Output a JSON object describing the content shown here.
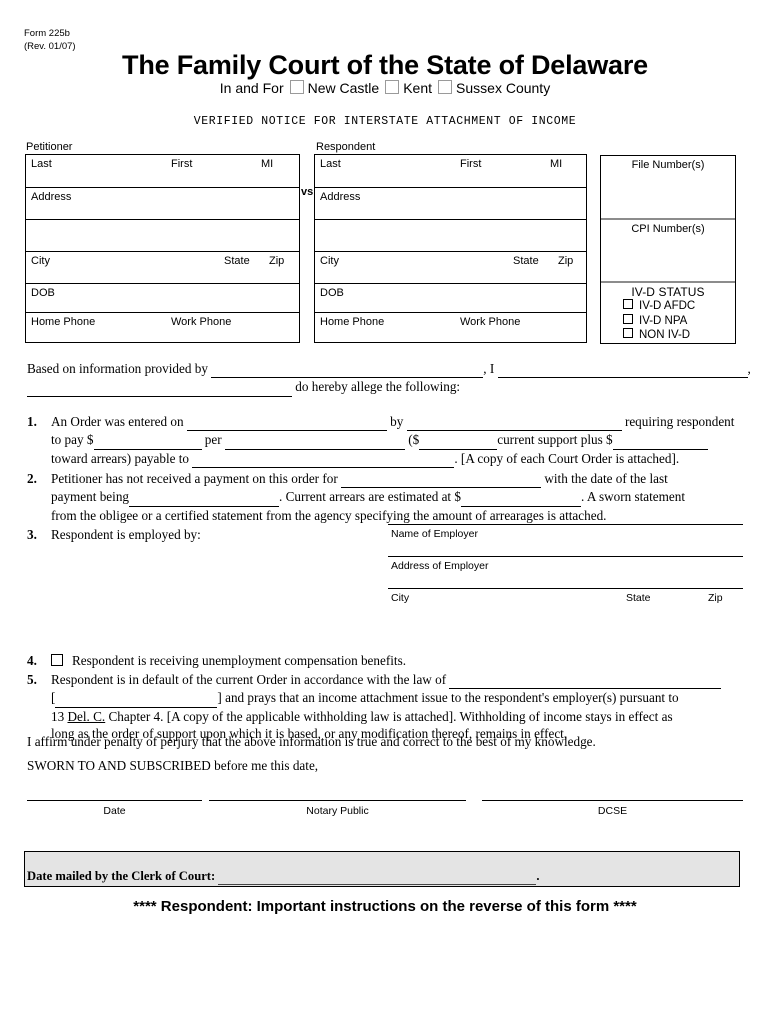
{
  "form": {
    "number": "Form 225b",
    "revision": "(Rev. 01/07)"
  },
  "header": {
    "title": "The Family Court of the State of Delaware",
    "in_and_for_label": "In and For",
    "counties": [
      "New Castle",
      "Kent",
      "Sussex County"
    ],
    "subtitle": "VERIFIED NOTICE FOR INTERSTATE ATTACHMENT OF INCOME"
  },
  "parties": {
    "petitioner_label": "Petitioner",
    "respondent_label": "Respondent",
    "vs": "vs",
    "fields": {
      "last": "Last",
      "first": "First",
      "mi": "MI",
      "address": "Address",
      "city": "City",
      "state": "State",
      "zip": "Zip",
      "dob": "DOB",
      "home_phone": "Home Phone",
      "work_phone": "Work Phone"
    }
  },
  "right_panel": {
    "file_number_label": "File Number(s)",
    "cpi_number_label": "CPI Number(s)",
    "ivd_status_title": "IV-D STATUS",
    "ivd_options": [
      "IV-D AFDC",
      "IV-D NPA",
      "NON IV-D"
    ]
  },
  "intro": {
    "line1_a": "Based on information provided by",
    "line1_b": ", I",
    "line1_c": ",",
    "line2": "do hereby allege the following:"
  },
  "items": {
    "item1": {
      "number": "1.",
      "a": "An Order was entered on",
      "b": "by",
      "c": "requiring  respondent",
      "d": "to pay $",
      "e": "per",
      "f": "($",
      "g": "current support plus $",
      "h": "toward arrears) payable to",
      "i": ". [A copy of each Court Order is attached]."
    },
    "item2": {
      "number": "2.",
      "a": "Petitioner has not received a payment on this order for",
      "b": "with  the  date  of  the  last",
      "c": "payment being",
      "d": ". Current arrears are estimated at $",
      "e": ".   A  sworn  statement",
      "f": "from the obligee or a certified statement from the agency specifying the amount of arrearages is attached."
    },
    "item3": {
      "number": "3.",
      "text": "Respondent is employed by:"
    },
    "item4": {
      "number": "4.",
      "text": "Respondent is receiving unemployment compensation benefits."
    },
    "item5": {
      "number": "5.",
      "a": "Respondent is in default of the current Order in accordance with the law of",
      "b": "[",
      "c": "] and prays that an income attachment issue to the respondent's employer(s) pursuant to",
      "d": "13",
      "e": "Del. C.",
      "f": "Chapter 4.  [A copy of the applicable withholding law is attached].  Withholding of income stays in effect as",
      "g": "long as the order of support upon which it is based, or any modification thereof, remains in effect,"
    }
  },
  "employer": {
    "name_label": "Name of Employer",
    "address_label": "Address of Employer",
    "city_label": "City",
    "state_label": "State",
    "zip_label": "Zip"
  },
  "affirmation": {
    "line1": "I affirm under penalty of perjury that the above information is true and correct to the best of my knowledge.",
    "line2": "SWORN TO AND SUBSCRIBED before me this date,"
  },
  "signatures": [
    "Date",
    "Notary Public",
    "DCSE"
  ],
  "mailed": {
    "label": "Date mailed by the Clerk of Court:",
    "trailing": "."
  },
  "notice": "**** Respondent:  Important instructions on the reverse of this form ****"
}
